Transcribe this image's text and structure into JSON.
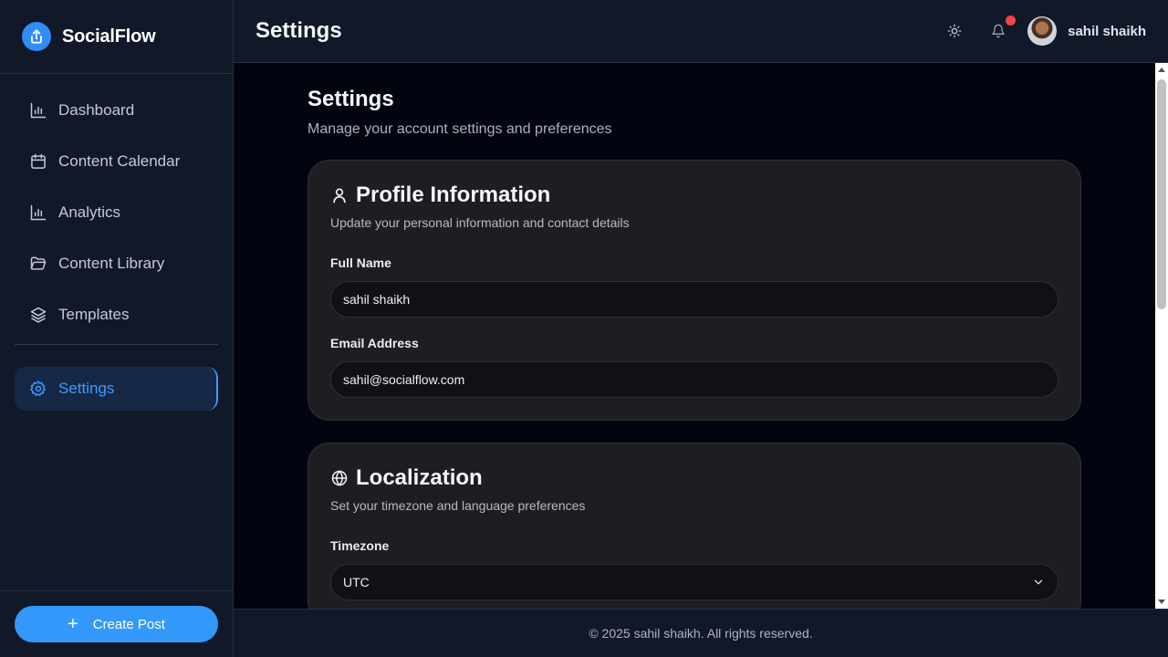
{
  "brand": {
    "name": "SocialFlow",
    "logo_icon": "upload-share-icon",
    "accent": "#2f8df5"
  },
  "sidebar": {
    "items": [
      {
        "label": "Dashboard",
        "icon": "bar-chart-icon"
      },
      {
        "label": "Content Calendar",
        "icon": "calendar-icon"
      },
      {
        "label": "Analytics",
        "icon": "bar-chart-icon"
      },
      {
        "label": "Content Library",
        "icon": "folder-open-icon"
      },
      {
        "label": "Templates",
        "icon": "layers-icon"
      }
    ],
    "active_item": {
      "label": "Settings",
      "icon": "gear-icon"
    },
    "create_button": "Create Post"
  },
  "header": {
    "title": "Settings",
    "user_name": "sahil shaikh",
    "theme_icon": "sun-icon",
    "notification_icon": "bell-icon"
  },
  "page": {
    "title": "Settings",
    "subtitle": "Manage your account settings and preferences"
  },
  "profile": {
    "title": "Profile Information",
    "subtitle": "Update your personal information and contact details",
    "full_name_label": "Full Name",
    "full_name_value": "sahil shaikh",
    "email_label": "Email Address",
    "email_value": "sahil@socialflow.com"
  },
  "localization": {
    "title": "Localization",
    "subtitle": "Set your timezone and language preferences",
    "timezone_label": "Timezone",
    "timezone_value": "UTC"
  },
  "footer": {
    "text": "© 2025 sahil shaikh. All rights reserved."
  },
  "colors": {
    "primary": "#3299fb",
    "notification": "#ef4444",
    "active_nav_text": "#3b9bff"
  }
}
